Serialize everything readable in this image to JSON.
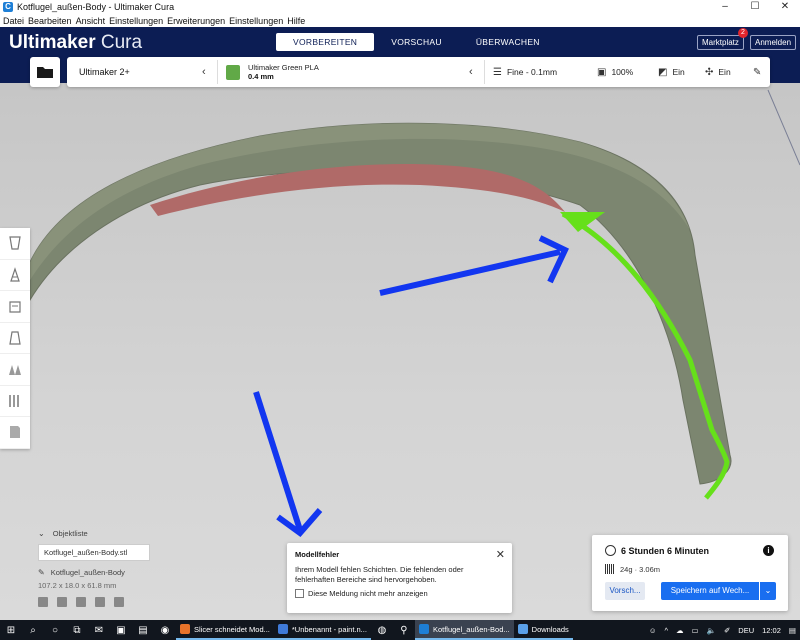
{
  "window": {
    "title": "Kotflugel_außen-Body - Ultimaker Cura",
    "controls": [
      "–",
      "☐",
      "✕"
    ]
  },
  "menu": [
    "Datei",
    "Bearbeiten",
    "Ansicht",
    "Einstellungen",
    "Erweiterungen",
    "Einstellungen",
    "Hilfe"
  ],
  "header": {
    "logo_bold": "Ultimaker",
    "logo_light": " Cura",
    "stages": [
      "VORBEREITEN",
      "VORSCHAU",
      "ÜBERWACHEN"
    ],
    "marketplace": "Marktplatz",
    "marketplace_badge": "2",
    "login": "Anmelden"
  },
  "printer": {
    "name": "Ultimaker 2+",
    "material": "Ultimaker Green PLA",
    "nozzle": "0.4 mm",
    "profile": "Fine - 0.1mm",
    "infill": "100%",
    "support": "Ein",
    "adhesion": "Ein"
  },
  "objects": {
    "header": "Objektliste",
    "item": "Kotflugel_außen-Body.stl",
    "name": "Kotflugel_außen-Body",
    "dims": "107.2 x 18.0 x 61.8 mm"
  },
  "message": {
    "title": "Modellfehler",
    "text": "Ihrem Modell fehlen Schichten. Die fehlenden oder fehlerhaften Bereiche sind hervorgehoben.",
    "checkbox": "Diese Meldung nicht mehr anzeigen"
  },
  "output": {
    "time": "6 Stunden 6 Minuten",
    "material": "24g · 3.06m",
    "preview": "Vorsch...",
    "save": "Speichern auf Wech..."
  },
  "taskbar": {
    "tasks": [
      "Slicer schneidet Mod...",
      "*Unbenannt - paint.n...",
      "Kotflugel_außen-Bod...",
      "Downloads"
    ],
    "lang": "DEU",
    "time": "12:02"
  },
  "colors": {
    "header_bg": "#0c1d54",
    "model": "#7c8670",
    "error_red": "#b06a68",
    "highlight_green": "#66e01a",
    "arrow_blue": "#1236f0"
  }
}
